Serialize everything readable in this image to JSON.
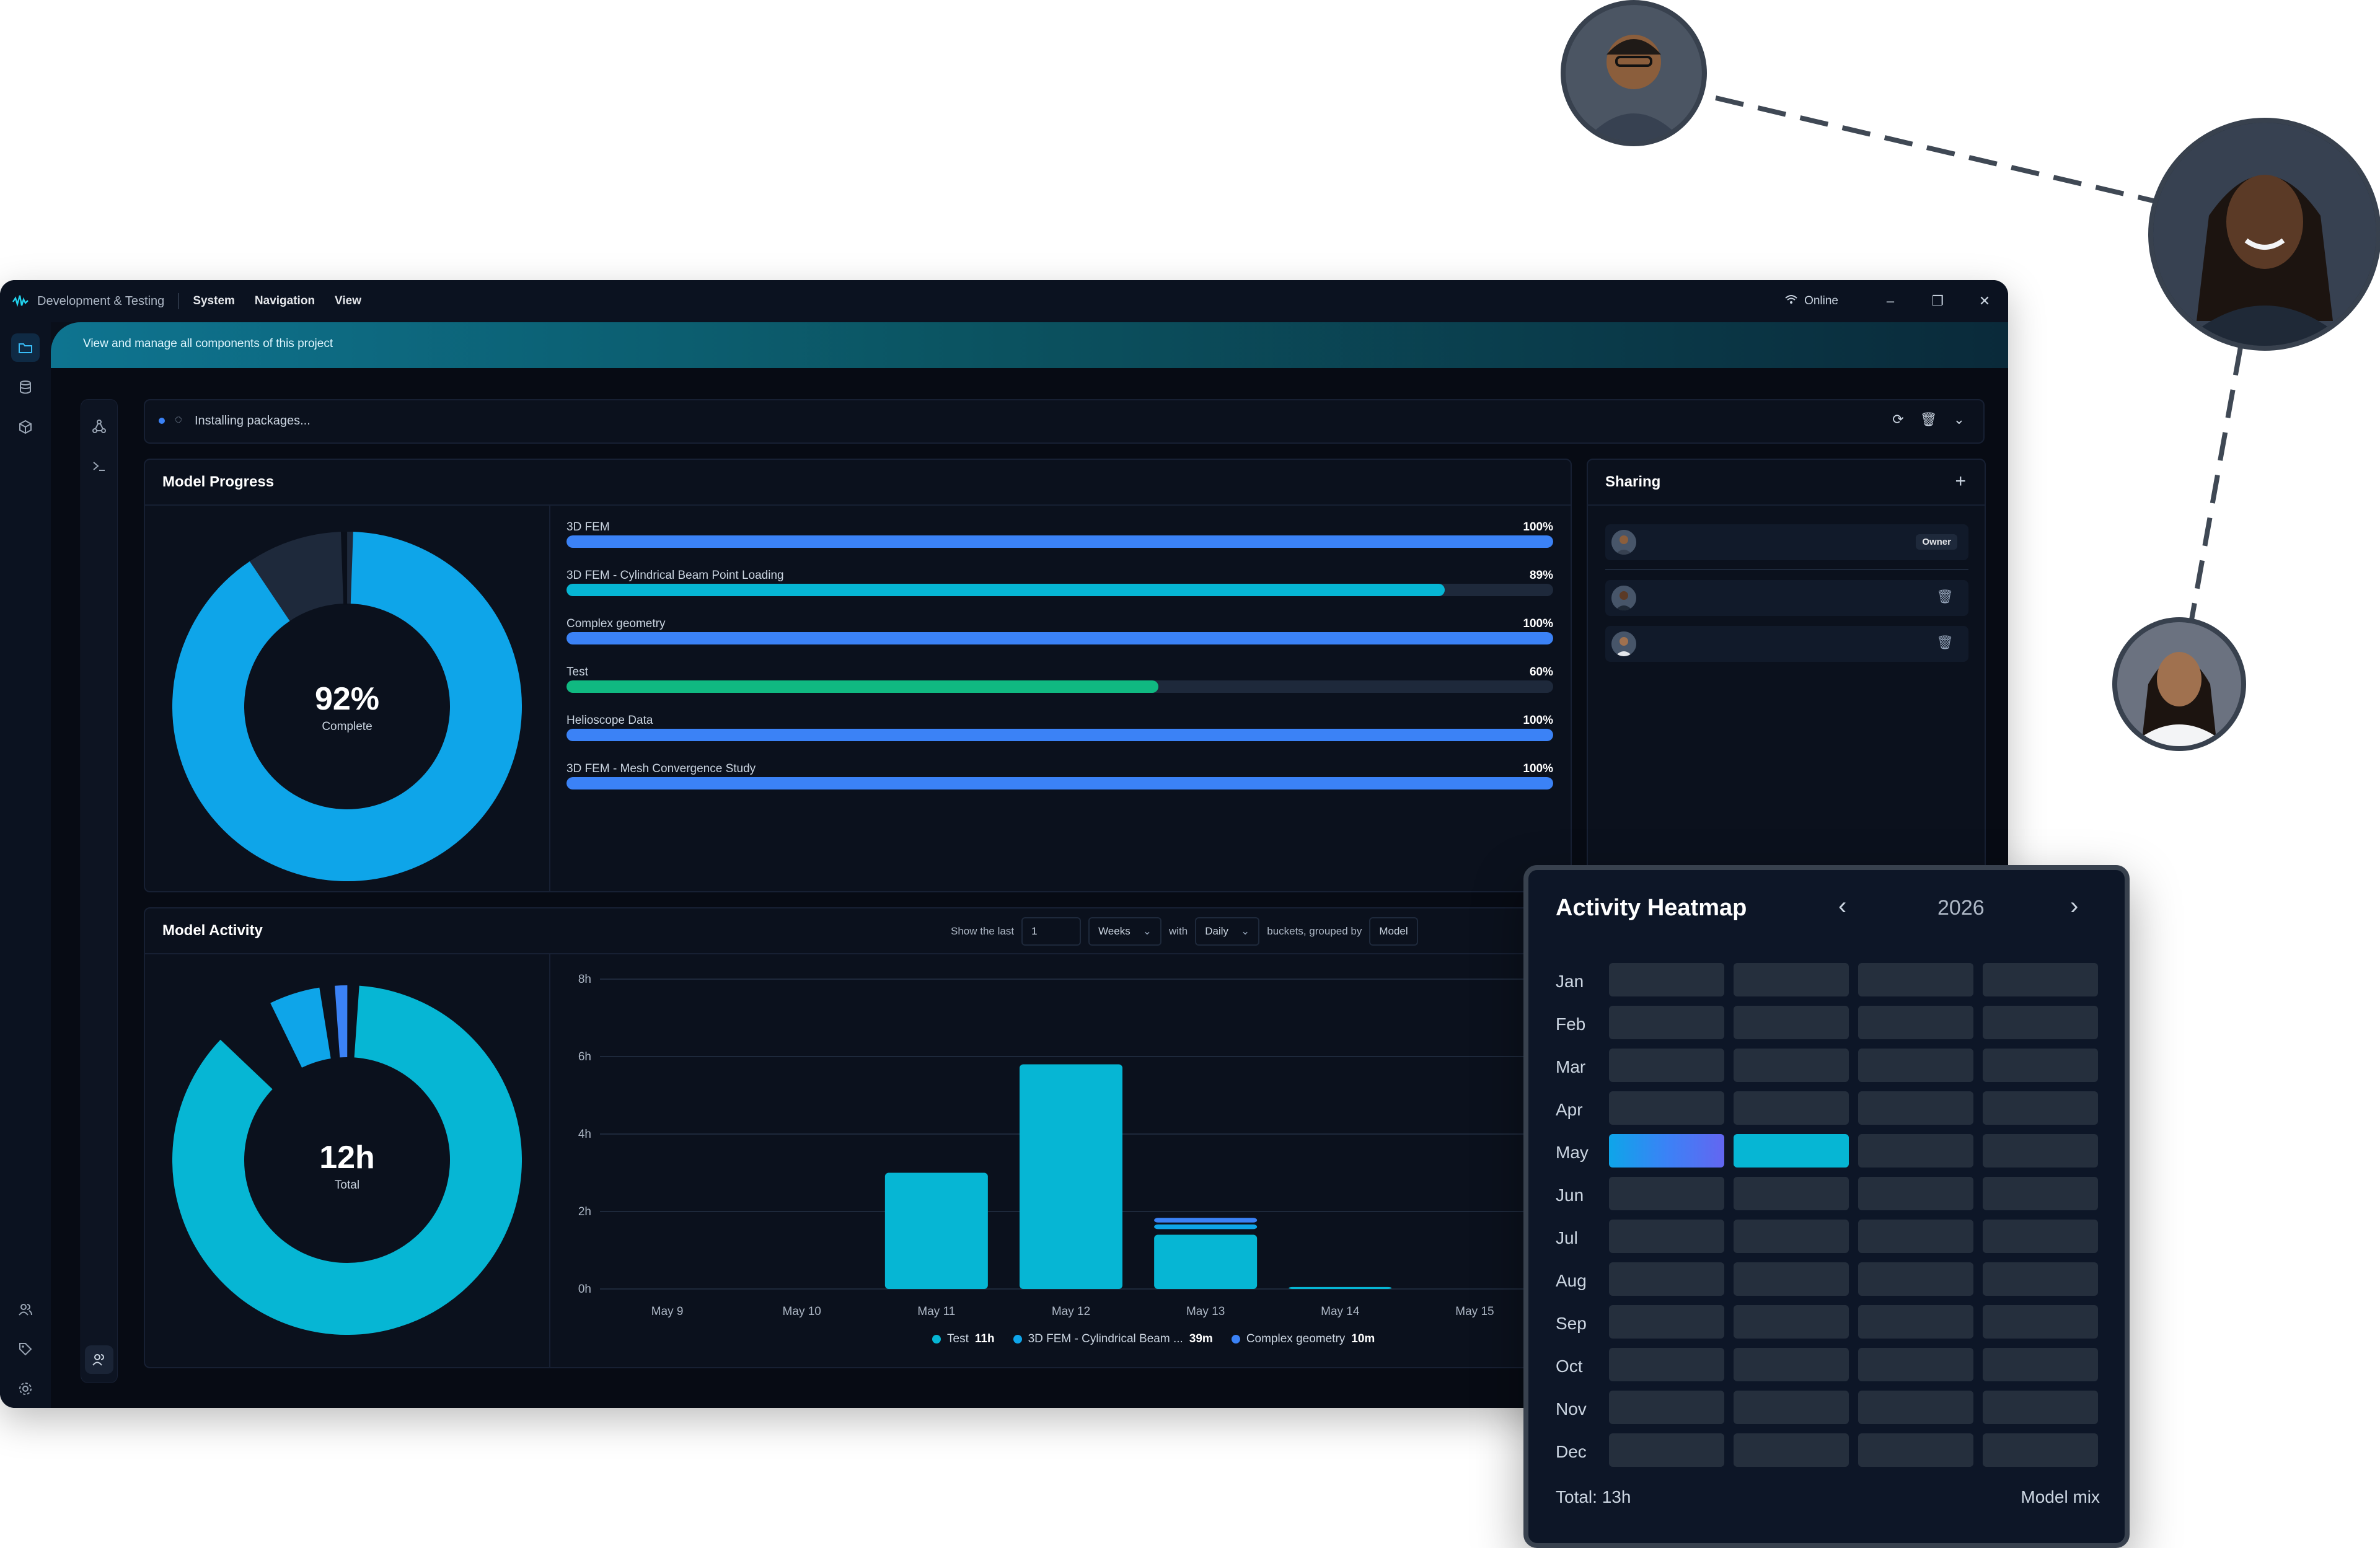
{
  "titlebar": {
    "app_title": "Development & Testing",
    "menus": [
      "System",
      "Navigation",
      "View"
    ],
    "status": "Online"
  },
  "banner": {
    "text": "View and manage all components of this project"
  },
  "statusbar": {
    "text": "Installing packages..."
  },
  "model_progress": {
    "title": "Model Progress",
    "percent_label": "92%",
    "percent_caption": "Complete",
    "items": [
      {
        "label": "3D FEM",
        "value_label": "100%",
        "value": 100,
        "color": "#3b82f6"
      },
      {
        "label": "3D FEM - Cylindrical Beam Point Loading",
        "value_label": "89%",
        "value": 89,
        "color": "#06b6d4"
      },
      {
        "label": "Complex geometry",
        "value_label": "100%",
        "value": 100,
        "color": "#3b82f6"
      },
      {
        "label": "Test",
        "value_label": "60%",
        "value": 60,
        "color": "#10b981"
      },
      {
        "label": "Helioscope Data",
        "value_label": "100%",
        "value": 100,
        "color": "#3b82f6"
      },
      {
        "label": "3D FEM - Mesh Convergence Study",
        "value_label": "100%",
        "value": 100,
        "color": "#3b82f6"
      }
    ]
  },
  "sharing": {
    "title": "Sharing",
    "owner_badge": "Owner"
  },
  "model_activity": {
    "title": "Model Activity",
    "controls": {
      "show_the_last": "Show the last",
      "count": "1",
      "unit": "Weeks",
      "with": "with",
      "bucket": "Daily",
      "buckets_grouped_by": "buckets, grouped by",
      "group": "Model"
    },
    "total_label": "12h",
    "total_caption": "Total",
    "legend": [
      {
        "name": "Test",
        "value": "11h",
        "color": "#06b6d4"
      },
      {
        "name": "3D FEM - Cylindrical Beam ...",
        "value": "39m",
        "color": "#0ea5e9"
      },
      {
        "name": "Complex geometry",
        "value": "10m",
        "color": "#3b82f6"
      }
    ]
  },
  "chart_data": {
    "type": "bar",
    "categories": [
      "May 9",
      "May 10",
      "May 11",
      "May 12",
      "May 13",
      "May 14",
      "May 15"
    ],
    "y_ticks": [
      "0h",
      "2h",
      "4h",
      "6h",
      "8h"
    ],
    "ylim": [
      0,
      8
    ],
    "series": [
      {
        "name": "Test",
        "values": [
          0,
          0,
          3,
          5.8,
          1.4,
          0.05,
          0
        ],
        "color": "#06b6d4"
      },
      {
        "name": "3D FEM - Cylindrical Beam ...",
        "values": [
          0,
          0,
          0,
          0,
          0.12,
          0,
          0
        ],
        "color": "#0ea5e9"
      },
      {
        "name": "Complex geometry",
        "values": [
          0,
          0,
          0,
          0,
          0.12,
          0,
          0
        ],
        "color": "#3b82f6"
      }
    ]
  },
  "heatmap": {
    "title": "Activity Heatmap",
    "year": "2026",
    "months": [
      "Jan",
      "Feb",
      "Mar",
      "Apr",
      "May",
      "Jun",
      "Jul",
      "Aug",
      "Sep",
      "Oct",
      "Nov",
      "Dec"
    ],
    "active": [
      {
        "month": "May",
        "week": 1,
        "style": "blue-gradient"
      },
      {
        "month": "May",
        "week": 2,
        "style": "cyan"
      }
    ],
    "total": "Total: 13h",
    "mix": "Model mix"
  }
}
